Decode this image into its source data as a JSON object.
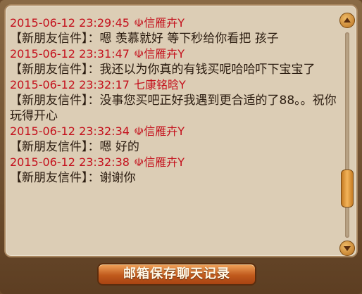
{
  "messages": [
    {
      "timestamp": "2015-06-12 23:29:45",
      "sender": "☫信雁卉Y",
      "sender_label": "【新朋友信件】：",
      "text": "嗯 羡慕就好 等下秒给你看把 孩子"
    },
    {
      "timestamp": "2015-06-12 23:31:47",
      "sender": "☫信雁卉Y",
      "sender_label": "【新朋友信件】：",
      "text": "我还以为你真的有钱买呢哈哈吓下宝宝了"
    },
    {
      "timestamp": "2015-06-12 23:32:17",
      "sender": "七康铭晗Y",
      "sender_label": "【新朋友信件】：",
      "text": "没事您买吧正好我遇到更合适的了88。。祝你玩得开心"
    },
    {
      "timestamp": "2015-06-12 23:32:34",
      "sender": "☫信雁卉Y",
      "sender_label": "【新朋友信件】：",
      "text": "嗯 好的"
    },
    {
      "timestamp": "2015-06-12 23:32:38",
      "sender": "☫信雁卉Y",
      "sender_label": "【新朋友信件】：",
      "text": "谢谢你"
    }
  ],
  "scroll": {
    "position_fraction": 0.82
  },
  "buttons": {
    "save_mail": "邮箱保存聊天记录"
  },
  "colors": {
    "timestamp": "#c4101c",
    "text": "#2b1c10",
    "panel_bg": "#dccdb5",
    "button": "#c05a1c"
  }
}
